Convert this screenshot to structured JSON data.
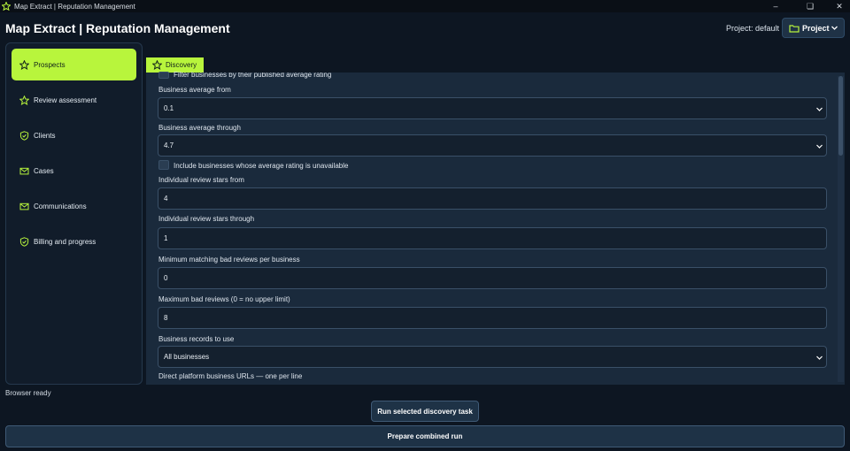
{
  "window": {
    "title": "Map Extract | Reputation Management",
    "icons": {
      "app": "star-icon",
      "minimize": "minimize-icon",
      "maximize": "restore-icon",
      "close": "close-icon"
    }
  },
  "header": {
    "title": "Map Extract | Reputation Management",
    "project_label": "Project: default",
    "project_button": "Project",
    "project_icon": "folder-icon"
  },
  "colors": {
    "accent": "#b8f53c",
    "background": "#0d1622",
    "panel": "#1a2a3c"
  },
  "sidebar": {
    "items": [
      {
        "label": "Prospects",
        "icon": "star-icon",
        "active": true
      },
      {
        "label": "Review assessment",
        "icon": "star-icon",
        "active": false
      },
      {
        "label": "Clients",
        "icon": "shield-check-icon",
        "active": false
      },
      {
        "label": "Cases",
        "icon": "envelope-icon",
        "active": false
      },
      {
        "label": "Communications",
        "icon": "envelope-icon",
        "active": false
      },
      {
        "label": "Billing and progress",
        "icon": "shield-check-icon",
        "active": false
      }
    ]
  },
  "tab": {
    "label": "Discovery",
    "icon": "star-icon"
  },
  "form": {
    "filter_by_published": "Filter businesses by their published average rating",
    "avg_from_label": "Business average from",
    "avg_from_value": "0.1",
    "avg_through_label": "Business average through",
    "avg_through_value": "4.7",
    "include_unavailable_label": "Include businesses whose average rating is unavailable",
    "stars_from_label": "Individual review stars from",
    "stars_from_value": "4",
    "stars_through_label": "Individual review stars through",
    "stars_through_value": "1",
    "min_bad_label": "Minimum matching bad reviews per business",
    "min_bad_value": "0",
    "max_bad_label": "Maximum bad reviews (0 = no upper limit)",
    "max_bad_value": "8",
    "records_label": "Business records to use",
    "records_value": "All businesses",
    "urls_label": "Direct platform business URLs — one per line"
  },
  "status": "Browser ready",
  "buttons": {
    "run": "Run selected discovery task",
    "prepare": "Prepare combined run"
  }
}
